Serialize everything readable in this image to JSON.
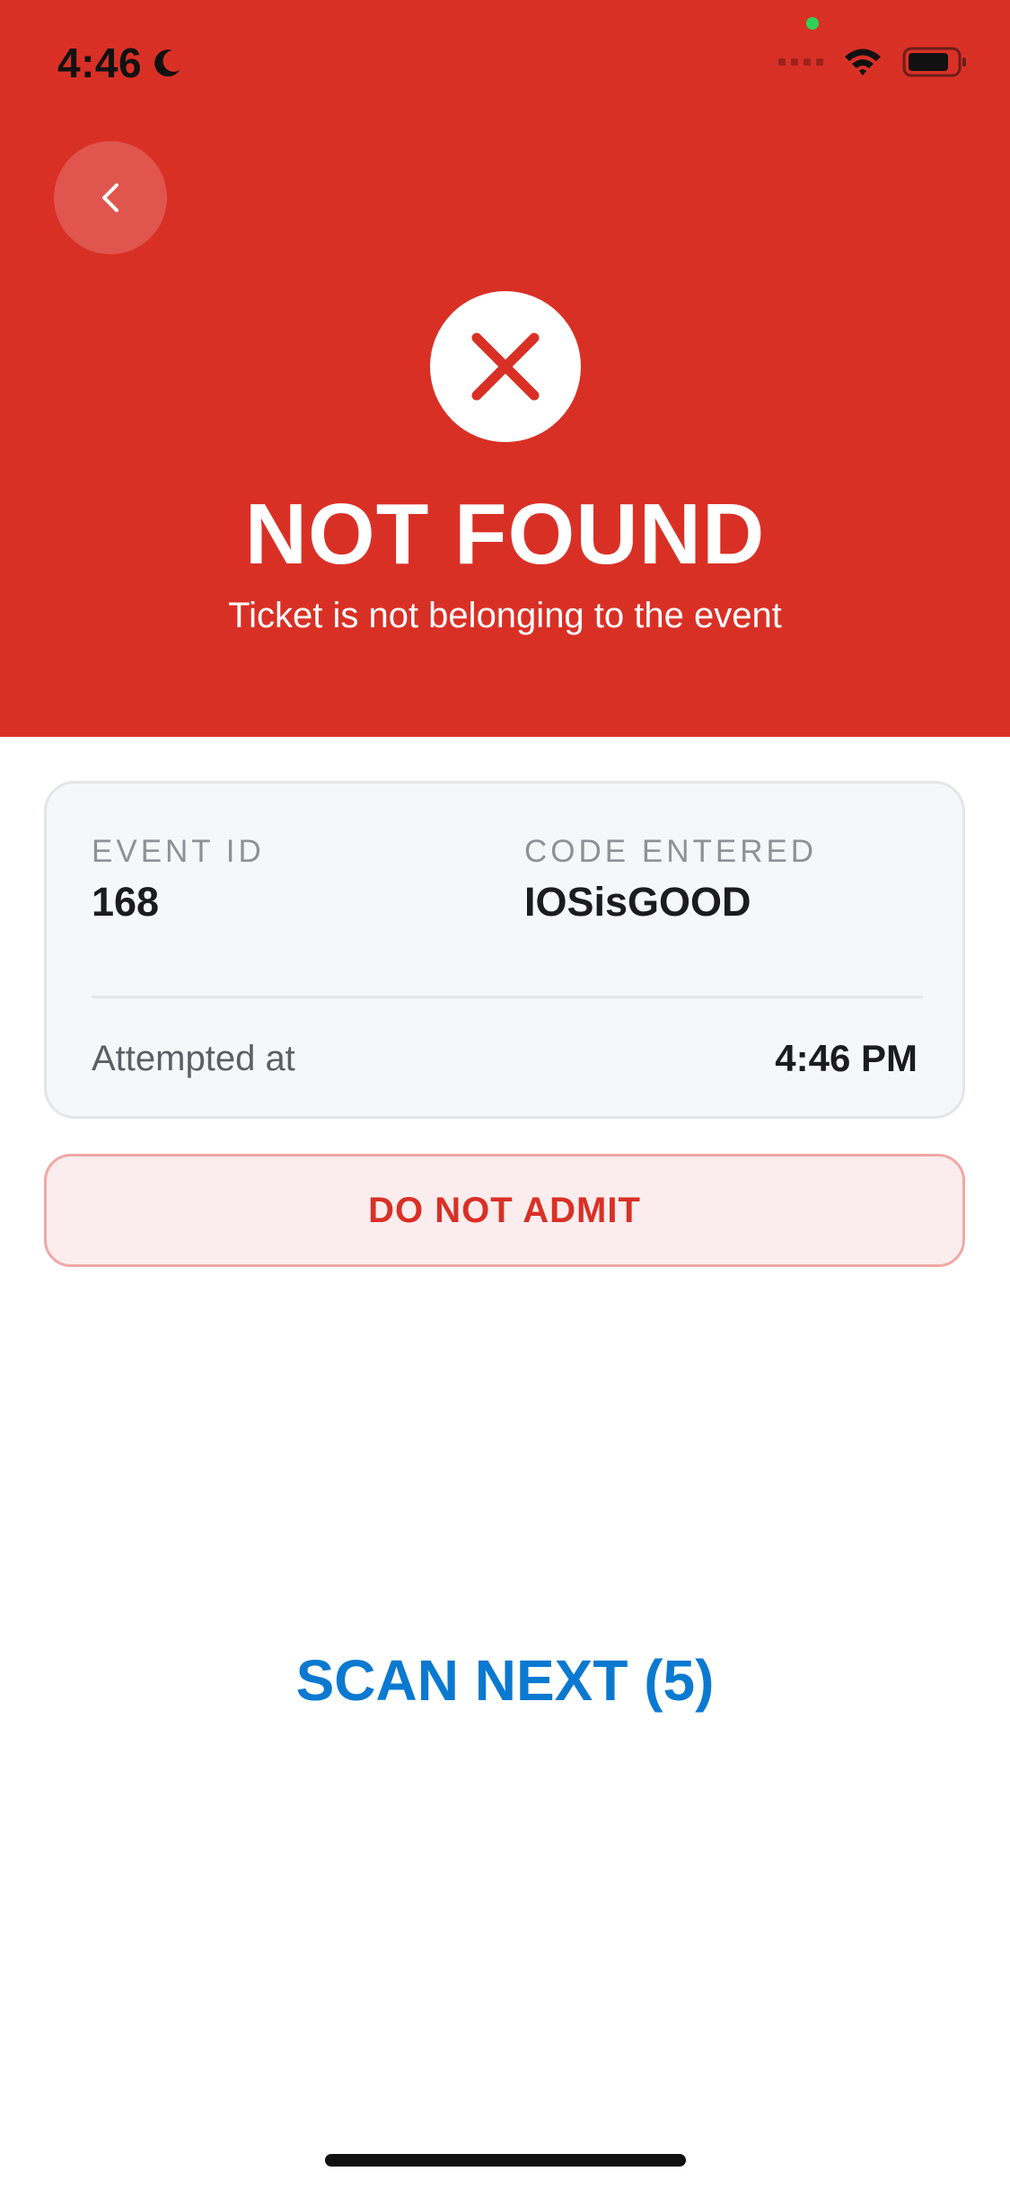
{
  "status_bar": {
    "time": "4:46"
  },
  "header": {
    "title": "NOT FOUND",
    "subtitle": "Ticket is not belonging to the event"
  },
  "details": {
    "event_id_label": "EVENT ID",
    "event_id_value": "168",
    "code_label": "CODE ENTERED",
    "code_value": "IOSisGOOD",
    "attempted_label": "Attempted at",
    "attempted_value": "4:46 PM"
  },
  "admit_banner": "DO NOT ADMIT",
  "scan_next_label": "SCAN NEXT (5)",
  "colors": {
    "header_red": "#d93026",
    "accent_blue": "#0b79d0",
    "banner_bg": "#fbeded"
  },
  "icons": {
    "back": "chevron-left-icon",
    "status": "x-circle-icon",
    "focus": "moon-icon",
    "wifi": "wifi-icon",
    "battery": "battery-icon"
  }
}
